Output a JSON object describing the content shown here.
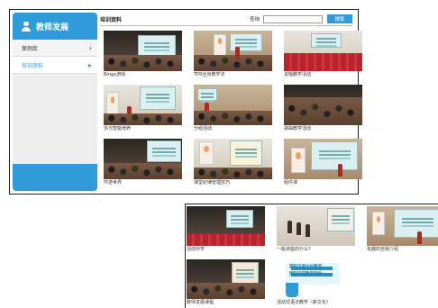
{
  "sidebar": {
    "title": "教师发展",
    "items": [
      {
        "label": "案例库",
        "chevron": "›"
      },
      {
        "label": "培训资料",
        "chevron": "▸"
      }
    ]
  },
  "header": {
    "section_title": "培训资料",
    "search_label": "查询",
    "search_value": "",
    "search_button": "搜索"
  },
  "grid": [
    {
      "caption": "Bingo游戏"
    },
    {
      "caption": "TPR全身教学法"
    },
    {
      "caption": "说唱教学活动"
    },
    {
      "caption": "多元智能培养"
    },
    {
      "caption": "分组活动"
    },
    {
      "caption": "歌曲教学活动"
    },
    {
      "caption": "环游世界"
    },
    {
      "caption": "课堂纪律管理技巧"
    },
    {
      "caption": "组件课"
    }
  ],
  "grid2": [
    {
      "caption": "活动中学"
    },
    {
      "caption": "一般讲座的什么?"
    },
    {
      "caption": "有趣的自我介绍"
    },
    {
      "caption": "教师发展课程"
    },
    {
      "caption": "活动式语法教学（新文化）"
    }
  ],
  "poster_text": {
    "line1": "国际汉语文化教学",
    "line2": "国际汉语教学专栏"
  }
}
